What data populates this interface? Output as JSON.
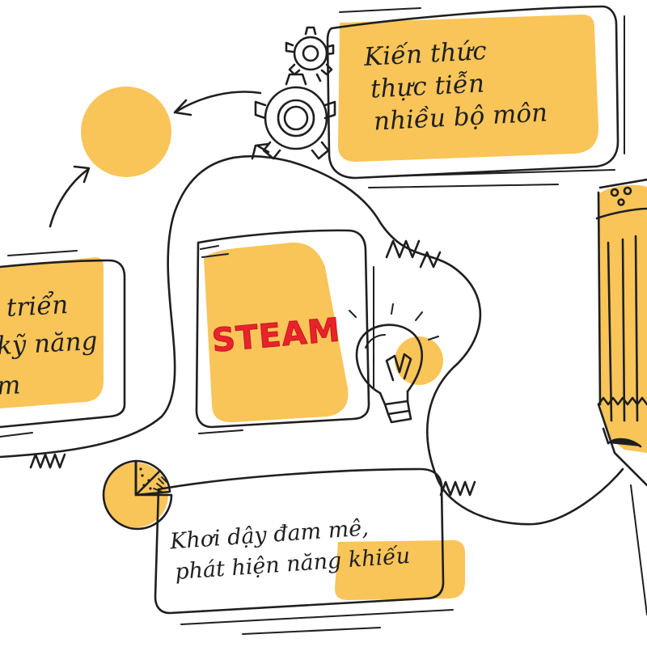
{
  "colors": {
    "accent": "#f9c559",
    "ink": "#1f1f1f",
    "steam": "#e8232b"
  },
  "center": {
    "label": "STEAM"
  },
  "top_right_box": {
    "lines": [
      "Kiến thức",
      "thực tiễn",
      "nhiều bộ môn"
    ]
  },
  "left_box": {
    "lines": [
      "triển",
      "kỹ năng",
      "m"
    ]
  },
  "bottom_box": {
    "lines": [
      "Khơi dậy đam mê,",
      "phát hiện năng khiếu"
    ]
  },
  "icons": [
    "gears-icon",
    "circle-node-icon",
    "lightbulb-icon",
    "pie-chart-icon",
    "pencil-icon"
  ]
}
